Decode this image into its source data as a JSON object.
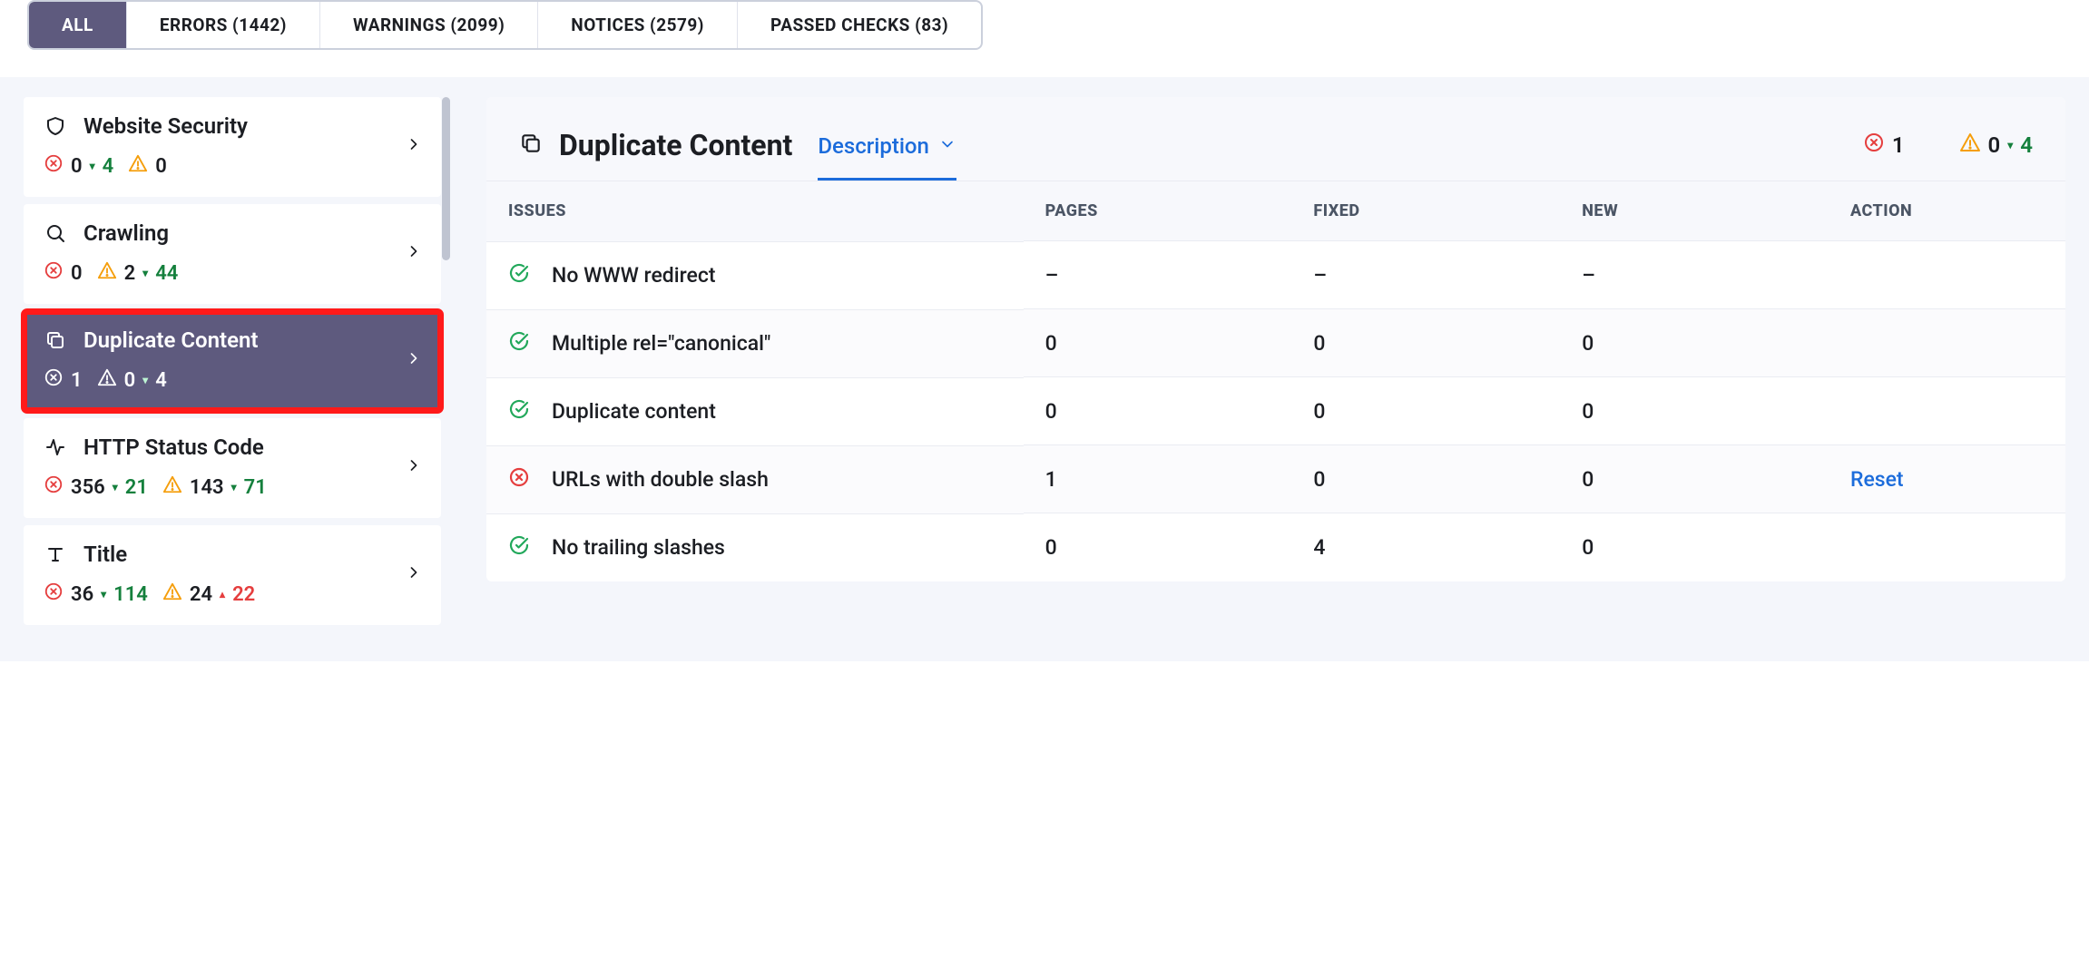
{
  "filters": {
    "all": "ALL",
    "errors": "ERRORS (1442)",
    "warnings": "WARNINGS (2099)",
    "notices": "NOTICES (2579)",
    "passed": "PASSED CHECKS (83)"
  },
  "sidebar": [
    {
      "id": "website-security",
      "label": "Website Security",
      "errors": "0",
      "errors_delta": "4",
      "errors_dir": "down",
      "warnings": "0",
      "warnings_delta": "",
      "warnings_dir": ""
    },
    {
      "id": "crawling",
      "label": "Crawling",
      "errors": "0",
      "errors_delta": "",
      "errors_dir": "",
      "warnings": "2",
      "warnings_delta": "44",
      "warnings_dir": "down"
    },
    {
      "id": "duplicate-content",
      "label": "Duplicate Content",
      "errors": "1",
      "errors_delta": "",
      "errors_dir": "",
      "warnings": "0",
      "warnings_delta": "4",
      "warnings_dir": "down"
    },
    {
      "id": "http-status-code",
      "label": "HTTP Status Code",
      "errors": "356",
      "errors_delta": "21",
      "errors_dir": "down",
      "warnings": "143",
      "warnings_delta": "71",
      "warnings_dir": "down"
    },
    {
      "id": "title",
      "label": "Title",
      "errors": "36",
      "errors_delta": "114",
      "errors_dir": "down",
      "warnings": "24",
      "warnings_delta": "22",
      "warnings_dir": "up"
    }
  ],
  "panel": {
    "title": "Duplicate Content",
    "dropdown_label": "Description",
    "stats": {
      "errors": "1",
      "warnings": "0",
      "warnings_delta": "4"
    },
    "columns": {
      "issues": "ISSUES",
      "pages": "PAGES",
      "fixed": "FIXED",
      "new": "NEW",
      "action": "ACTION"
    },
    "rows": [
      {
        "status": "pass",
        "issue": "No WWW redirect",
        "pages": "–",
        "fixed": "–",
        "new": "–",
        "action": ""
      },
      {
        "status": "pass",
        "issue": "Multiple rel=\"canonical\"",
        "pages": "0",
        "fixed": "0",
        "new": "0",
        "action": ""
      },
      {
        "status": "pass",
        "issue": "Duplicate content",
        "pages": "0",
        "fixed": "0",
        "new": "0",
        "action": ""
      },
      {
        "status": "error",
        "issue": "URLs with double slash",
        "pages": "1",
        "fixed": "0",
        "new": "0",
        "action": "Reset"
      },
      {
        "status": "pass",
        "issue": "No trailing slashes",
        "pages": "0",
        "fixed": "4",
        "new": "0",
        "action": ""
      }
    ]
  }
}
